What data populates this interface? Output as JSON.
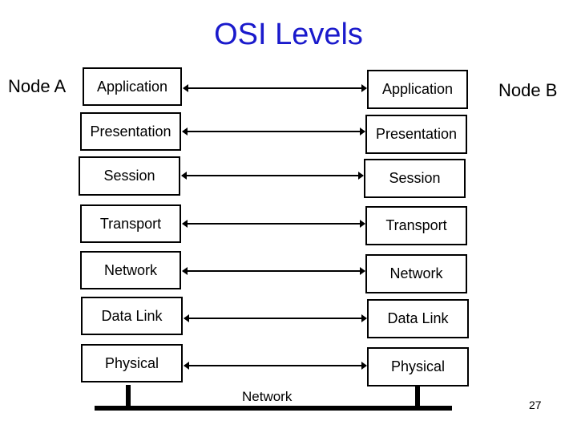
{
  "title": "OSI Levels",
  "node_a": "Node A",
  "node_b": "Node B",
  "layers": [
    {
      "left": "Application",
      "right": "Application"
    },
    {
      "left": "Presentation",
      "right": "Presentation"
    },
    {
      "left": "Session",
      "right": "Session"
    },
    {
      "left": "Transport",
      "right": "Transport"
    },
    {
      "left": "Network",
      "right": "Network"
    },
    {
      "left": "Data Link",
      "right": "Data Link"
    },
    {
      "left": "Physical",
      "right": "Physical"
    }
  ],
  "network_label": "Network",
  "page_number": "27",
  "colors": {
    "title": "#1a1acc",
    "line": "#000000"
  }
}
